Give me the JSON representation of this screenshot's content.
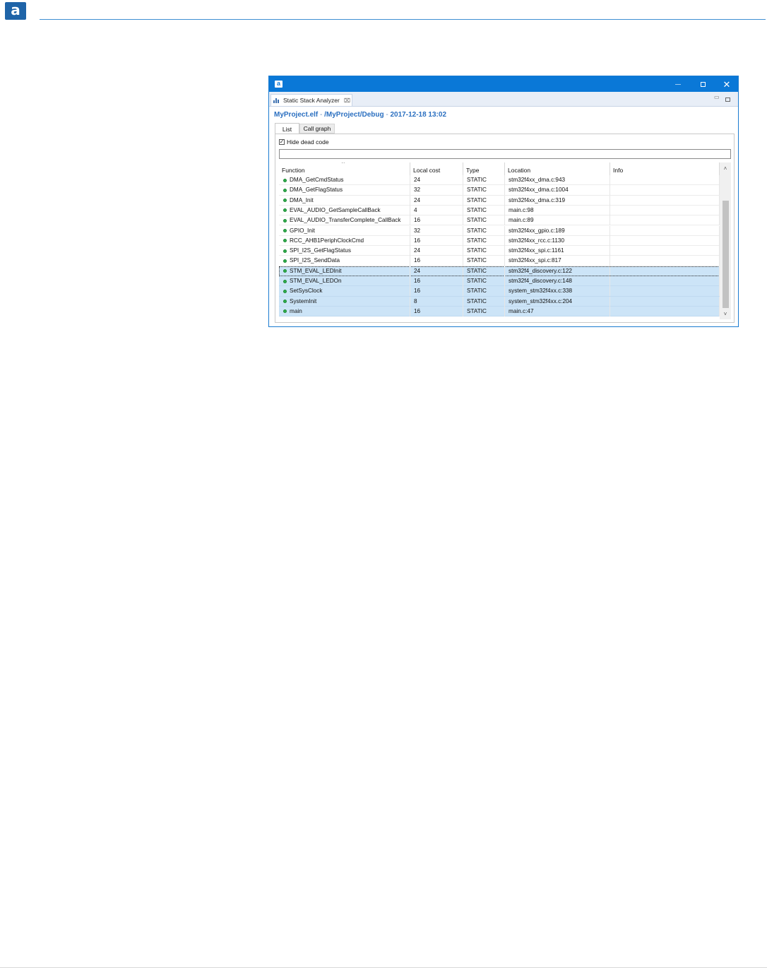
{
  "doc": {
    "logo_letter": "a"
  },
  "window": {
    "icon_letter": "a",
    "controls": {
      "close": "✕"
    }
  },
  "view": {
    "tab_label": "Static Stack Analyzer",
    "tab_close": "⌧",
    "min": "▭"
  },
  "header": {
    "file": "MyProject.elf",
    "separator": " - ",
    "path": "/MyProject/Debug",
    "timestamp": "2017-12-18 13:02"
  },
  "tabs": [
    {
      "label": "List",
      "active": true
    },
    {
      "label": "Call graph",
      "active": false
    }
  ],
  "filter": {
    "hide_dead_code_label": "Hide dead code",
    "hide_dead_code_checked": true,
    "checkmark": "✓",
    "search_value": "",
    "search_placeholder": ""
  },
  "table": {
    "sort_indicator": "^",
    "columns": [
      "Function",
      "Local cost",
      "Type",
      "Location",
      "Info"
    ],
    "rows": [
      {
        "function": "DMA_GetCmdStatus",
        "local_cost": "24",
        "type": "STATIC",
        "location": "stm32f4xx_dma.c:943",
        "info": "",
        "selected": false
      },
      {
        "function": "DMA_GetFlagStatus",
        "local_cost": "32",
        "type": "STATIC",
        "location": "stm32f4xx_dma.c:1004",
        "info": "",
        "selected": false
      },
      {
        "function": "DMA_Init",
        "local_cost": "24",
        "type": "STATIC",
        "location": "stm32f4xx_dma.c:319",
        "info": "",
        "selected": false
      },
      {
        "function": "EVAL_AUDIO_GetSampleCallBack",
        "local_cost": "4",
        "type": "STATIC",
        "location": "main.c:98",
        "info": "",
        "selected": false
      },
      {
        "function": "EVAL_AUDIO_TransferComplete_CallBack",
        "local_cost": "16",
        "type": "STATIC",
        "location": "main.c:89",
        "info": "",
        "selected": false
      },
      {
        "function": "GPIO_Init",
        "local_cost": "32",
        "type": "STATIC",
        "location": "stm32f4xx_gpio.c:189",
        "info": "",
        "selected": false
      },
      {
        "function": "RCC_AHB1PeriphClockCmd",
        "local_cost": "16",
        "type": "STATIC",
        "location": "stm32f4xx_rcc.c:1130",
        "info": "",
        "selected": false
      },
      {
        "function": "SPI_I2S_GetFlagStatus",
        "local_cost": "24",
        "type": "STATIC",
        "location": "stm32f4xx_spi.c:1161",
        "info": "",
        "selected": false
      },
      {
        "function": "SPI_I2S_SendData",
        "local_cost": "16",
        "type": "STATIC",
        "location": "stm32f4xx_spi.c:817",
        "info": "",
        "selected": false
      },
      {
        "function": "STM_EVAL_LEDInit",
        "local_cost": "24",
        "type": "STATIC",
        "location": "stm32f4_discovery.c:122",
        "info": "",
        "selected": true,
        "focused": true
      },
      {
        "function": "STM_EVAL_LEDOn",
        "local_cost": "16",
        "type": "STATIC",
        "location": "stm32f4_discovery.c:148",
        "info": "",
        "selected": true
      },
      {
        "function": "SetSysClock",
        "local_cost": "16",
        "type": "STATIC",
        "location": "system_stm32f4xx.c:338",
        "info": "",
        "selected": true
      },
      {
        "function": "SystemInit",
        "local_cost": "8",
        "type": "STATIC",
        "location": "system_stm32f4xx.c:204",
        "info": "",
        "selected": true
      },
      {
        "function": "main",
        "local_cost": "16",
        "type": "STATIC",
        "location": "main.c:47",
        "info": "",
        "selected": true
      }
    ],
    "scroll_up": "˄",
    "scroll_down": "˅"
  },
  "colors": {
    "title_bar": "#0a78d7",
    "path_text": "#2a6fc0",
    "selection": "#cce4f7",
    "status_dot": "#2fae4b"
  }
}
